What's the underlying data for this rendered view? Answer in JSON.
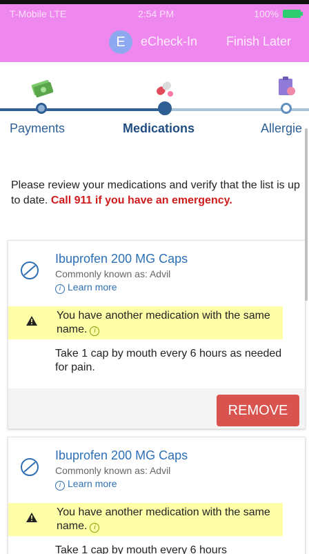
{
  "status_bar": {
    "carrier": "T-Mobile  LTE",
    "time": "2:54 PM",
    "battery": "100%"
  },
  "header": {
    "badge_letter": "E",
    "title": "eCheck-In",
    "finish_label": "Finish Later"
  },
  "steps": [
    {
      "label": "Payments",
      "state": "done"
    },
    {
      "label": "Medications",
      "state": "active"
    },
    {
      "label": "Allergie",
      "state": "future"
    }
  ],
  "intro": {
    "text": "Please review your medications and verify that the list is up to date. ",
    "warning": "Call 911 if you have an emergency."
  },
  "medications": [
    {
      "name": "Ibuprofen 200 MG Caps",
      "known_as": "Commonly known as: Advil",
      "learn_more": "Learn more",
      "alert": "You have another medication with the same name.",
      "instructions": "Take 1 cap by mouth every 6 hours as needed for pain.",
      "remove_label": "REMOVE"
    },
    {
      "name": "Ibuprofen 200 MG Caps",
      "known_as": "Commonly known as: Advil",
      "learn_more": "Learn more",
      "alert": "You have another medication with the same name.",
      "instructions": "Take 1 cap by mouth every 6 hours"
    }
  ],
  "colors": {
    "header_bg": "#ee88ee",
    "primary": "#2d5f94",
    "link": "#2d6fb5",
    "warning_text": "#d01b1b",
    "alert_bg": "#ffffa8",
    "remove_bg": "#d9534f"
  },
  "icons": {
    "payments_icon": "money-icon",
    "medications_icon": "pill-icon",
    "allergies_icon": "allergy-icon"
  }
}
